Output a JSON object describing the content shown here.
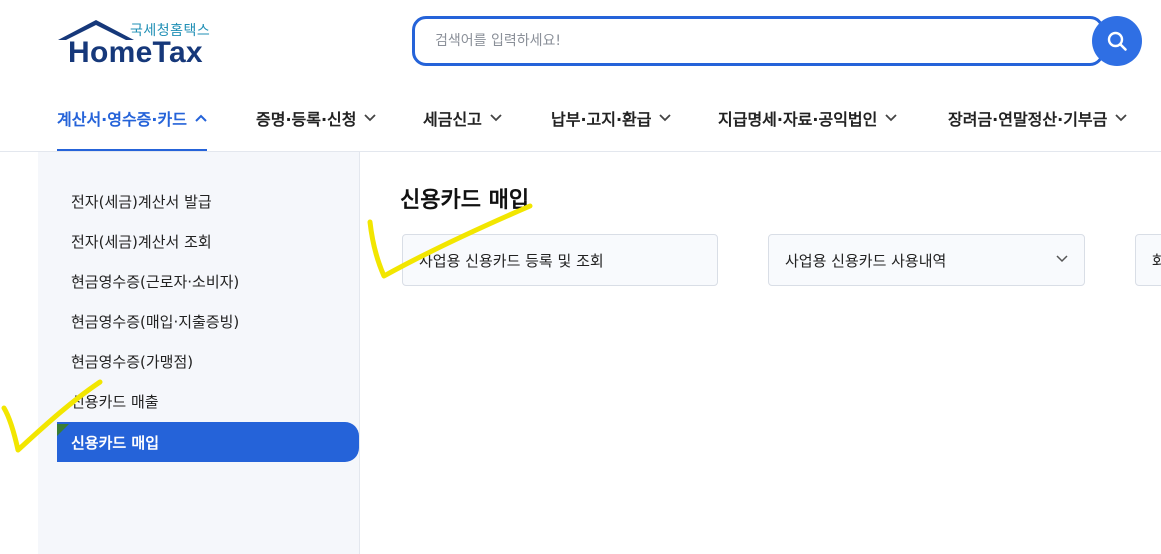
{
  "logo": {
    "sub_text": "국세청홈택스",
    "main_text": "HomeTax"
  },
  "search": {
    "placeholder": "검색어를 입력하세요!",
    "value": ""
  },
  "nav": {
    "items": [
      {
        "label": "계산서·영수증·카드",
        "active": true
      },
      {
        "label": "증명·등록·신청",
        "active": false
      },
      {
        "label": "세금신고",
        "active": false
      },
      {
        "label": "납부·고지·환급",
        "active": false
      },
      {
        "label": "지급명세·자료·공익법인",
        "active": false
      },
      {
        "label": "장려금·연말정산·기부금",
        "active": false
      }
    ]
  },
  "sidebar": {
    "items": [
      {
        "label": "전자(세금)계산서 발급"
      },
      {
        "label": "전자(세금)계산서 조회"
      },
      {
        "label": "현금영수증(근로자·소비자)"
      },
      {
        "label": "현금영수증(매입·지출증빙)"
      },
      {
        "label": "현금영수증(가맹점)"
      },
      {
        "label": "신용카드 매출"
      },
      {
        "label": "신용카드 매입",
        "active": true
      }
    ]
  },
  "main": {
    "title": "신용카드 매입",
    "cards": [
      {
        "label": "사업용 신용카드 등록 및 조회"
      },
      {
        "label": "사업용 신용카드 사용내역"
      },
      {
        "label": "화"
      }
    ]
  },
  "colors": {
    "primary": "#2563d9",
    "logo_navy": "#16387a",
    "logo_teal": "#1f8fb5",
    "annotation_yellow": "#f2e600"
  }
}
